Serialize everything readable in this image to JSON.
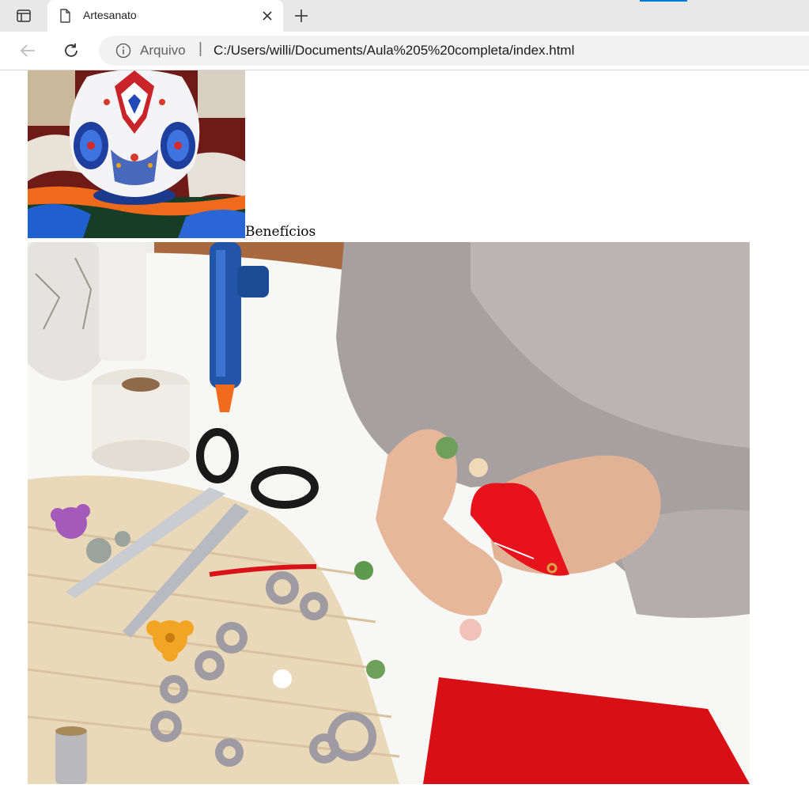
{
  "browser": {
    "tab": {
      "title": "Artesanato"
    },
    "address_bar": {
      "security_label": "Arquivo",
      "separator": "|",
      "url": "C:/Users/willi/Documents/Aula%205%20completa/index.html"
    },
    "accent_color": "#0078d4"
  },
  "page": {
    "images": [
      {
        "name": "vase-image",
        "depicts": "painted ceramic vase with blue and red floral patterns on a patterned rug"
      },
      {
        "name": "crafting-image",
        "depicts": "hands sewing red felt beside scissors, glue gun, yarn spool and crochet pieces"
      }
    ],
    "heading": "Benefícios"
  }
}
